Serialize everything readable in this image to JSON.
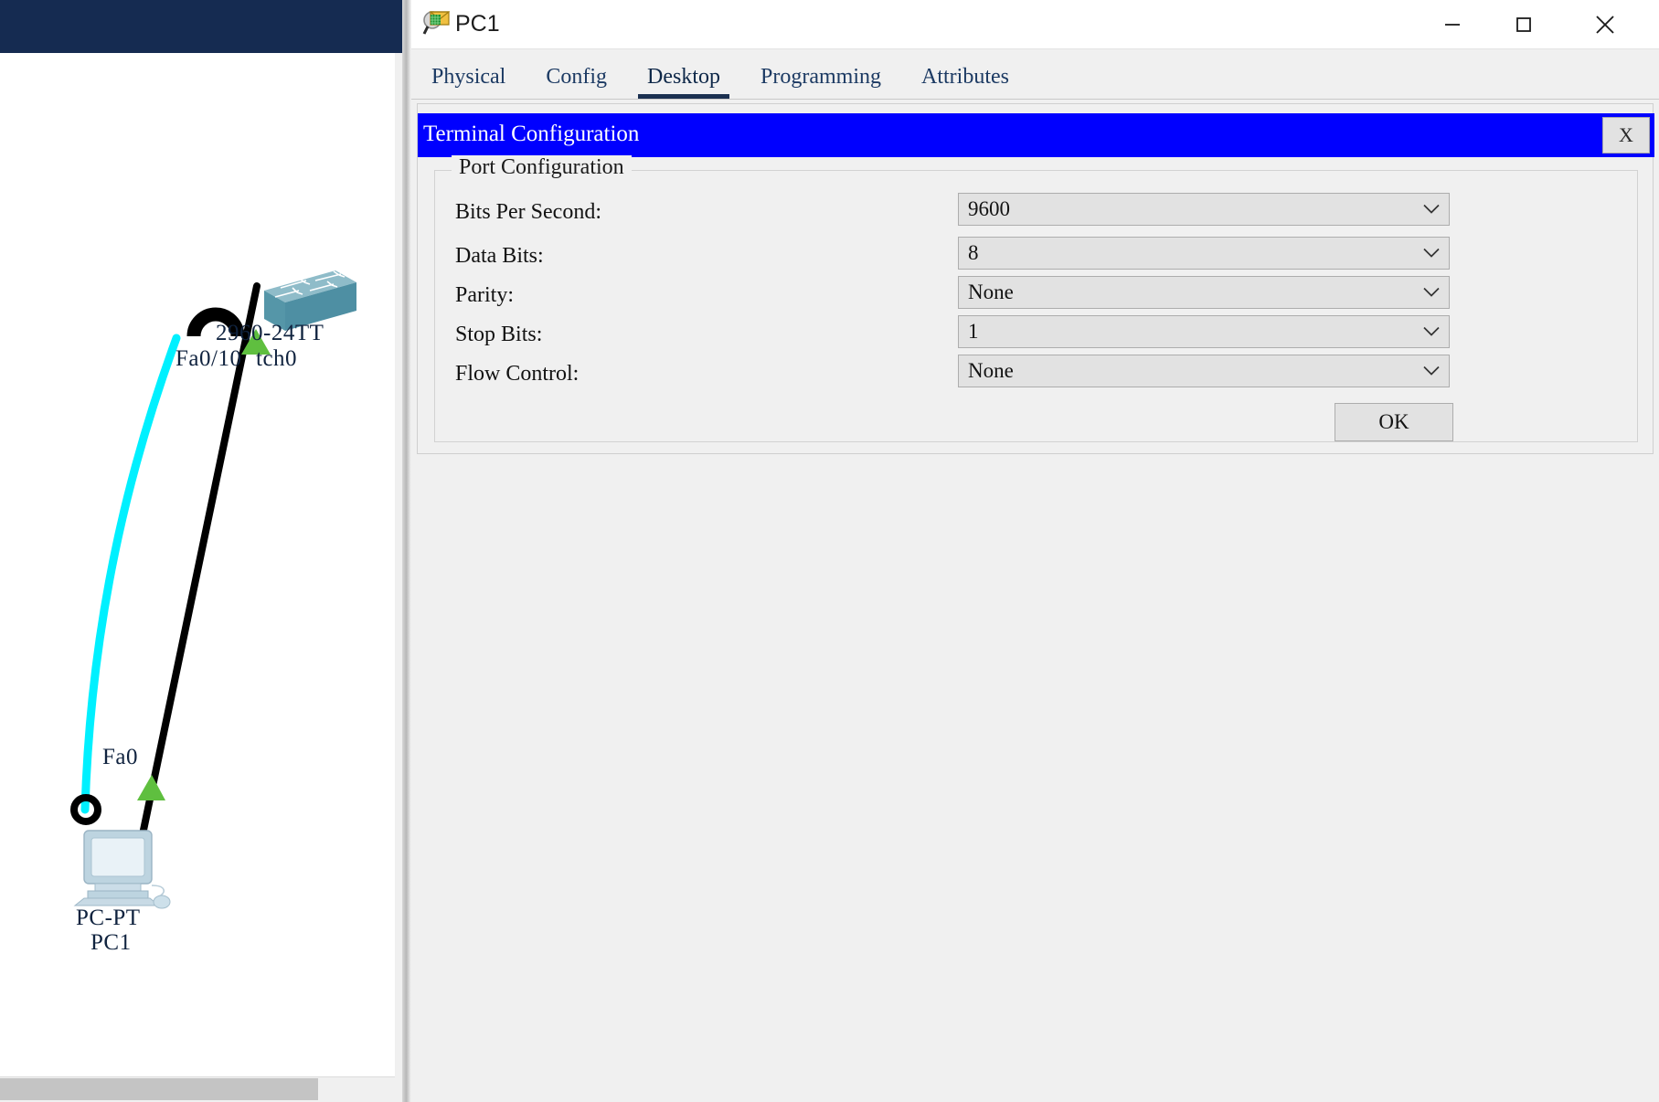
{
  "status_bar": {
    "coords": "y: 368"
  },
  "window": {
    "title": "PC1",
    "icon": "pc-magnifier-icon",
    "controls": {
      "minimize": "minimize-icon",
      "maximize": "maximize-icon",
      "close": "close-icon"
    }
  },
  "tabs": [
    {
      "label": "Physical",
      "active": false
    },
    {
      "label": "Config",
      "active": false
    },
    {
      "label": "Desktop",
      "active": true
    },
    {
      "label": "Programming",
      "active": false
    },
    {
      "label": "Attributes",
      "active": false
    }
  ],
  "dialog": {
    "title": "Terminal Configuration",
    "close_label": "X",
    "title_bg": "#0000ff",
    "title_fg": "#ffffff",
    "group_legend": "Port Configuration",
    "fields": [
      {
        "label": "Bits Per Second:",
        "value": "9600"
      },
      {
        "label": "Data Bits:",
        "value": "8"
      },
      {
        "label": "Parity:",
        "value": "None"
      },
      {
        "label": "Stop Bits:",
        "value": "1"
      },
      {
        "label": "Flow Control:",
        "value": "None"
      }
    ],
    "ok_label": "OK"
  },
  "topology": {
    "switch": {
      "model_label": "2960-24TT",
      "name_label": "tch0",
      "port_label": "Fa0/10"
    },
    "pc": {
      "model_label": "PC-PT",
      "name_label": "PC1",
      "port_label": "Fa0"
    },
    "links": {
      "console_color": "#00f0ff",
      "ethernet_color": "#000000",
      "status_color": "#5fbf3f"
    }
  }
}
